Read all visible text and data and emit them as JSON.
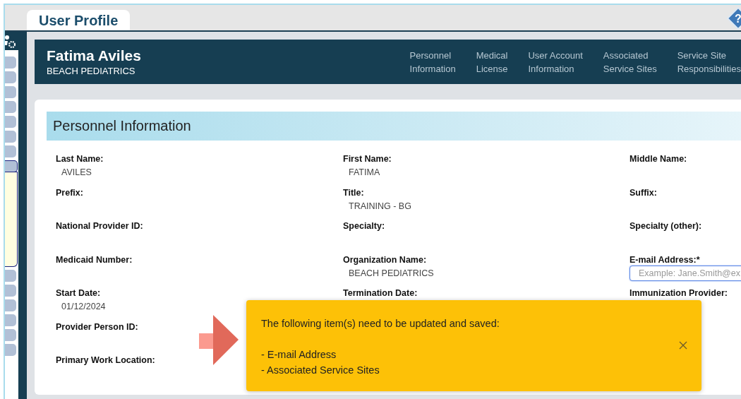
{
  "tab": {
    "label": "User Profile",
    "selected": true
  },
  "help": {
    "symbol": "?"
  },
  "sidebar": {
    "tabs": [
      {
        "selected": false
      },
      {
        "selected": false
      },
      {
        "selected": false
      },
      {
        "selected": false
      },
      {
        "selected": false
      },
      {
        "selected": false
      },
      {
        "selected": false
      },
      {
        "selected": true
      },
      {
        "selected": false
      },
      {
        "selected": false
      },
      {
        "selected": false
      },
      {
        "selected": false
      },
      {
        "selected": false
      },
      {
        "selected": false
      }
    ]
  },
  "header": {
    "name": "Fatima Aviles",
    "organization": "BEACH PEDIATRICS",
    "nav": [
      {
        "line1": "Personnel",
        "line2": "Information"
      },
      {
        "line1": "Medical",
        "line2": "License"
      },
      {
        "line1": "User Account",
        "line2": "Information"
      },
      {
        "line1": "Associated",
        "line2": "Service Sites"
      },
      {
        "line1": "Service Site",
        "line2": "Responsibilities"
      }
    ]
  },
  "section": {
    "title": "Personnel Information",
    "rows": [
      [
        {
          "label": "Last Name:",
          "value": "AVILES"
        },
        {
          "label": "First Name:",
          "value": "FATIMA"
        },
        {
          "label": "Middle Name:"
        }
      ],
      [
        {
          "label": "Prefix:"
        },
        {
          "label": "Title:",
          "value": "TRAINING - BG"
        },
        {
          "label": "Suffix:"
        }
      ],
      [
        {
          "label": "National Provider ID:"
        },
        {
          "label": "Specialty:"
        },
        {
          "label": "Specialty (other):"
        }
      ],
      [
        {
          "label": "Medicaid Number:"
        },
        {
          "label": "Organization Name:",
          "value": "BEACH PEDIATRICS"
        },
        {
          "label": "E-mail Address:*",
          "kind": "input",
          "placeholder": "Example: Jane.Smith@ex",
          "focused": true
        }
      ],
      [
        {
          "label": "Start Date:",
          "value": "01/12/2024"
        },
        {
          "label": "Termination Date:"
        },
        {
          "label": "Immunization Provider:"
        }
      ],
      [
        {
          "label": "Provider Person ID:"
        }
      ],
      [
        {
          "label": "Primary Work Location:"
        }
      ]
    ]
  },
  "alert": {
    "message": "The following item(s) need to be updated and saved:",
    "items": [
      "- E-mail Address",
      "- Associated Service Sites"
    ]
  }
}
